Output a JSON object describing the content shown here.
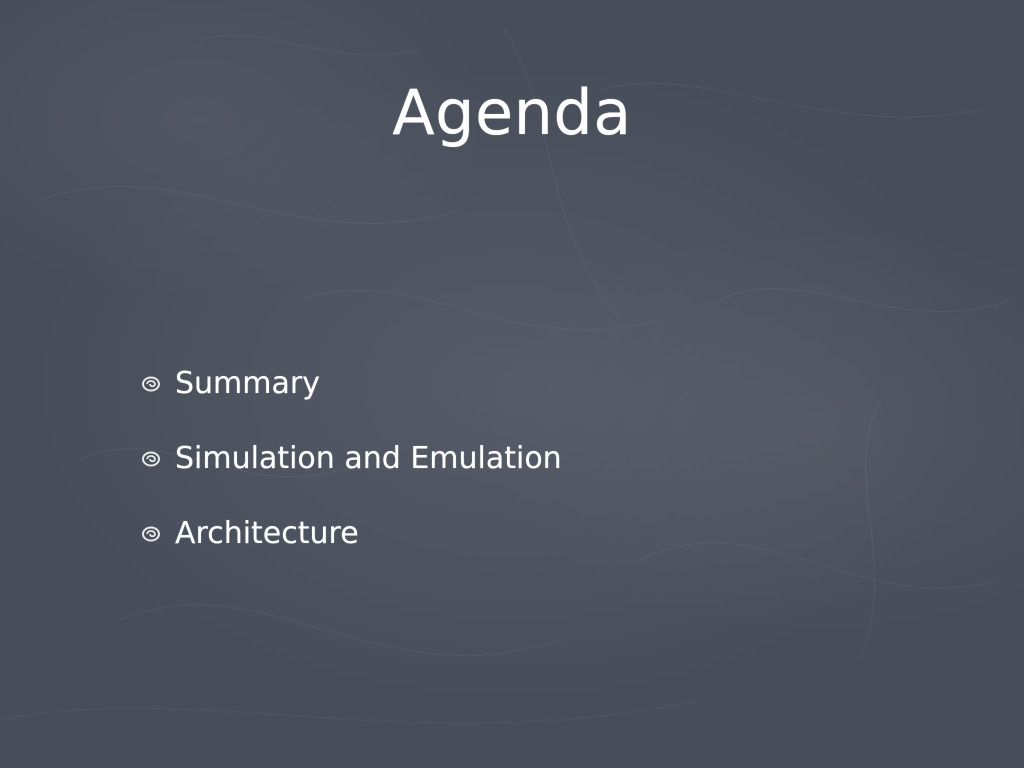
{
  "slide": {
    "title": "Agenda",
    "bullets": [
      {
        "label": "Summary"
      },
      {
        "label": "Simulation and Emulation"
      },
      {
        "label": "Architecture"
      }
    ],
    "bullet_icon": "chalk-swirl-icon",
    "colors": {
      "background": "#4a505c",
      "text": "#ffffff"
    }
  }
}
